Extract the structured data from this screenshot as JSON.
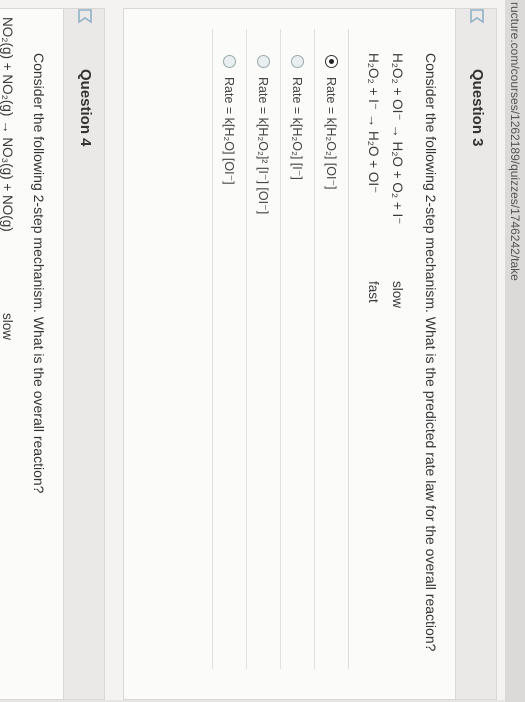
{
  "url": "ructure.com/courses/1262189/quizzes/1746242/take",
  "q3": {
    "title": "Question 3",
    "prompt": "Consider the following 2-step mechanism.  What is the predicted rate law for the overall reaction?",
    "steps": [
      {
        "equation": "H₂O₂ + OI⁻ → H₂O + O₂ + I⁻",
        "speed": "slow"
      },
      {
        "equation": "H₂O₂ + I⁻ → H₂O + OI⁻",
        "speed": "fast"
      }
    ],
    "options": [
      {
        "text": "Rate = k[H₂O₂] [OI⁻]",
        "selected": true
      },
      {
        "text": "Rate = k[H₂O₂] [I⁻]",
        "selected": false
      },
      {
        "text": "Rate = k[H₂O₂]² [I⁻] [OI⁻]",
        "selected": false
      },
      {
        "text": "Rate = k[H₂O] [OI⁻]",
        "selected": false
      }
    ]
  },
  "q4": {
    "title": "Question 4",
    "prompt": "Consider the following 2-step mechanism.  What is the overall reaction?",
    "step_partial": "NO₂(g) + NO₂(g) → NO₃(g) + NO(g)",
    "speed": "slow"
  },
  "colors": {
    "selected_radio": "#222222",
    "flag": "#8fb3c7"
  },
  "icons": {
    "flag": "flag-icon"
  }
}
